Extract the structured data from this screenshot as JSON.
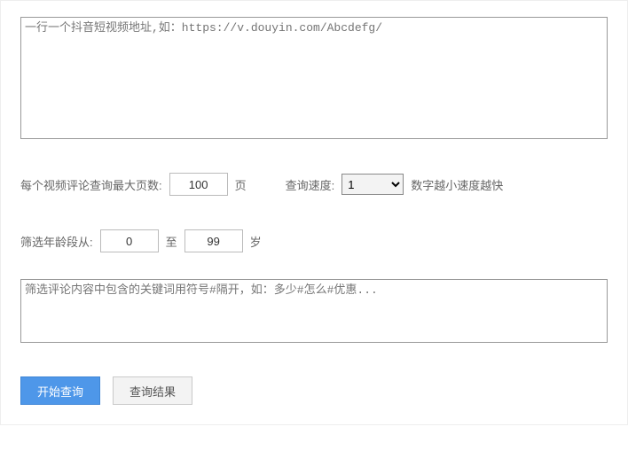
{
  "urls": {
    "placeholder": "一行一个抖音短视频地址,如：https://v.douyin.com/Abcdefg/",
    "value": ""
  },
  "maxPages": {
    "label": "每个视频评论查询最大页数:",
    "value": "100",
    "unit": "页"
  },
  "speed": {
    "label": "查询速度:",
    "value": "1",
    "hint": "数字越小速度越快"
  },
  "age": {
    "label": "筛选年龄段从:",
    "from": "0",
    "sep": "至",
    "to": "99",
    "unit": "岁"
  },
  "keywords": {
    "placeholder": "筛选评论内容中包含的关键词用符号#隔开，如：多少#怎么#优惠...",
    "value": ""
  },
  "buttons": {
    "start": "开始查询",
    "results": "查询结果"
  }
}
